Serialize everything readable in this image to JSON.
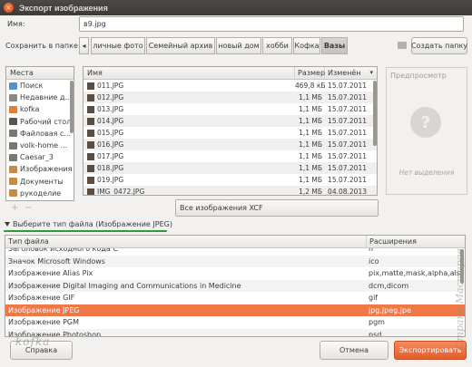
{
  "window": {
    "title": "Экспорт изображения",
    "close_glyph": "×"
  },
  "name": {
    "label": "Имя:",
    "value": "в9.jpg"
  },
  "save_in": {
    "label": "Сохранить в папке",
    "crumbs": [
      "личные фото",
      "Семейный архив",
      "новый дом",
      "хобби",
      "Кофка",
      "Вазы"
    ],
    "create_folder": "Создать папку",
    "nav_left": "◂"
  },
  "places": {
    "header": "Места",
    "items": [
      {
        "label": "Поиск",
        "icon": "search-icon",
        "color": "#5a8fc7"
      },
      {
        "label": "Недавние д...",
        "icon": "clock-icon",
        "color": "#888"
      },
      {
        "label": "kofka",
        "icon": "home-folder-icon",
        "color": "#d9813d"
      },
      {
        "label": "Рабочий стол",
        "icon": "desktop-icon",
        "color": "#555"
      },
      {
        "label": "Файловая с...",
        "icon": "drive-icon",
        "color": "#777"
      },
      {
        "label": "volk-home ...",
        "icon": "drive-icon",
        "color": "#777"
      },
      {
        "label": "Caesar_3",
        "icon": "drive-icon",
        "color": "#777"
      },
      {
        "label": "Изображения",
        "icon": "folder-icon",
        "color": "#c58a4a"
      },
      {
        "label": "Документы",
        "icon": "folder-icon",
        "color": "#c58a4a"
      },
      {
        "label": "рукоделие",
        "icon": "folder-icon",
        "color": "#c58a4a"
      }
    ],
    "add": "+",
    "remove": "−"
  },
  "files": {
    "columns": {
      "name": "Имя",
      "size": "Размер",
      "date": "Изменён",
      "sort": "▾"
    },
    "rows": [
      {
        "name": "011.JPG",
        "size": "469,8 кБ",
        "date": "15.07.2011"
      },
      {
        "name": "012.JPG",
        "size": "1,1 МБ",
        "date": "15.07.2011"
      },
      {
        "name": "013.JPG",
        "size": "1,1 МБ",
        "date": "15.07.2011"
      },
      {
        "name": "014.JPG",
        "size": "1,1 МБ",
        "date": "15.07.2011"
      },
      {
        "name": "015.JPG",
        "size": "1,1 МБ",
        "date": "15.07.2011"
      },
      {
        "name": "016.JPG",
        "size": "1,1 МБ",
        "date": "15.07.2011"
      },
      {
        "name": "017.JPG",
        "size": "1,1 МБ",
        "date": "15.07.2011"
      },
      {
        "name": "018.JPG",
        "size": "1,1 МБ",
        "date": "15.07.2011"
      },
      {
        "name": "019.JPG",
        "size": "1,1 МБ",
        "date": "15.07.2011"
      },
      {
        "name": "IMG_0472.JPG",
        "size": "1,2 МБ",
        "date": "04.08.2013"
      }
    ],
    "filter": "Все изображения XCF"
  },
  "preview": {
    "header": "Предпросмотр",
    "empty": "Нет выделения"
  },
  "filetype": {
    "toggle": "Выберите тип файла (Изображение JPEG)",
    "columns": {
      "type": "Тип файла",
      "ext": "Расширения"
    },
    "rows": [
      {
        "type": "Заголовок исходного кода C",
        "ext": "h"
      },
      {
        "type": "Значок Microsoft Windows",
        "ext": "ico"
      },
      {
        "type": "Изображение Alias Pix",
        "ext": "pix,matte,mask,alpha,als"
      },
      {
        "type": "Изображение Digital Imaging and Communications in Medicine",
        "ext": "dcm,dicom"
      },
      {
        "type": "Изображение GIF",
        "ext": "gif"
      },
      {
        "type": "Изображение JPEG",
        "ext": "jpg,jpeg,jpe",
        "selected": true
      },
      {
        "type": "Изображение PGM",
        "ext": "pgm"
      },
      {
        "type": "Изображение Photoshop",
        "ext": "psd"
      }
    ]
  },
  "buttons": {
    "help": "Справка",
    "cancel": "Отмена",
    "export": "Экспортировать"
  },
  "watermarks": {
    "bottom": "kofka",
    "side": "Страна Мастеров"
  }
}
